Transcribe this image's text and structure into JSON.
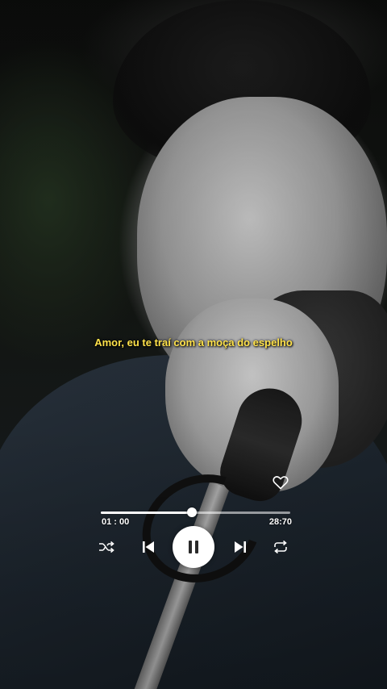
{
  "lyric": "Amor, eu te traí com a moça do espelho",
  "player": {
    "current_time": "01 : 00",
    "total_time": "28:70",
    "progress": 0.48,
    "liked": false,
    "state": "playing",
    "icons": {
      "like": "heart-outline-icon",
      "shuffle": "shuffle-icon",
      "previous": "skip-previous-icon",
      "play_pause": "pause-icon",
      "next": "skip-next-icon",
      "repeat": "repeat-icon"
    }
  },
  "colors": {
    "lyric_text": "#ffe24a",
    "controls": "#ffffff",
    "play_button_bg": "#ffffff",
    "play_button_icon": "#2a2a2a"
  }
}
